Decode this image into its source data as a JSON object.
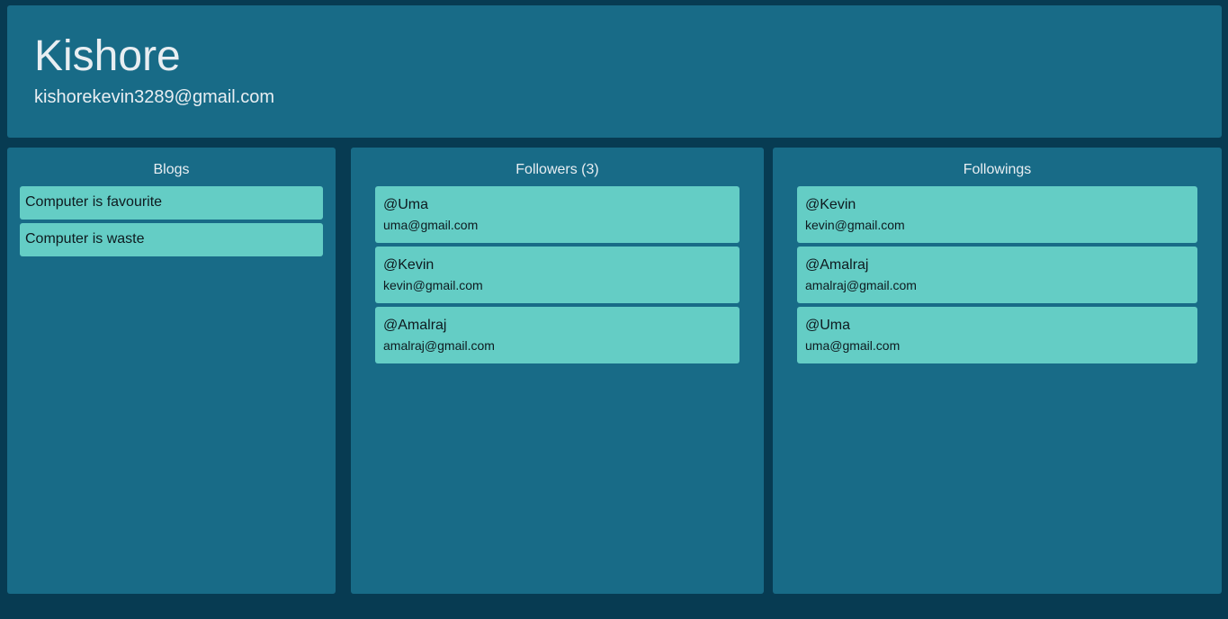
{
  "profile": {
    "name": "Kishore",
    "email": "kishorekevin3289@gmail.com"
  },
  "blogs": {
    "title": "Blogs",
    "items": [
      {
        "title": "Computer is favourite"
      },
      {
        "title": "Computer is waste"
      }
    ]
  },
  "followers": {
    "title": "Followers (3)",
    "users": [
      {
        "handle": "@Uma",
        "email": "uma@gmail.com"
      },
      {
        "handle": "@Kevin",
        "email": "kevin@gmail.com"
      },
      {
        "handle": "@Amalraj",
        "email": "amalraj@gmail.com"
      }
    ]
  },
  "followings": {
    "title": "Followings",
    "users": [
      {
        "handle": "@Kevin",
        "email": "kevin@gmail.com"
      },
      {
        "handle": "@Amalraj",
        "email": "amalraj@gmail.com"
      },
      {
        "handle": "@Uma",
        "email": "uma@gmail.com"
      }
    ]
  },
  "colors": {
    "background": "#073b52",
    "panel": "#186b87",
    "card": "#64cdc5",
    "text_light": "#e8eef2",
    "text_dark": "#0e1a1f"
  }
}
